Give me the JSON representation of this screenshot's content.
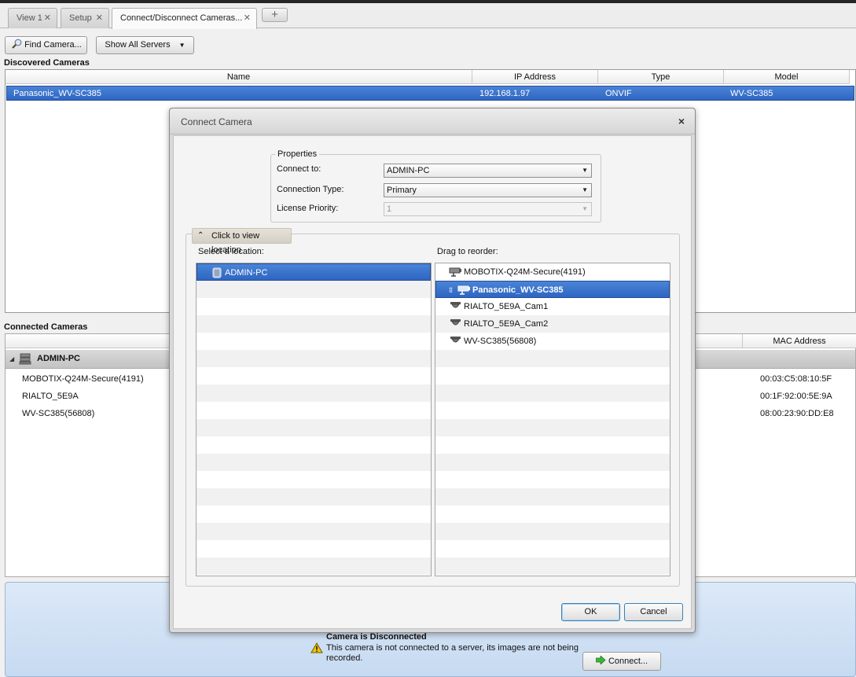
{
  "tabs": [
    {
      "label": "View 1",
      "active": false
    },
    {
      "label": "Setup",
      "active": false
    },
    {
      "label": "Connect/Disconnect Cameras...",
      "active": true
    }
  ],
  "add_tab_label": "+",
  "toolbar": {
    "find_camera_label": "Find Camera...",
    "show_all_servers_label": "Show All Servers"
  },
  "discovered": {
    "title": "Discovered Cameras",
    "columns": [
      "Name",
      "IP Address",
      "Type",
      "Model"
    ],
    "rows": [
      {
        "name": "Panasonic_WV-SC385",
        "ip": "192.168.1.97",
        "type": "ONVIF",
        "model": "WV-SC385"
      }
    ]
  },
  "connected": {
    "title": "Connected Cameras",
    "mac_column": "MAC Address",
    "server": "ADMIN-PC",
    "rows": [
      {
        "name": "MOBOTIX-Q24M-Secure(4191)",
        "mac": "00:03:C5:08:10:5F"
      },
      {
        "name": "RIALTO_5E9A",
        "mac": "00:1F:92:00:5E:9A"
      },
      {
        "name": "WV-SC385(56808)",
        "mac": "08:00:23:90:DD:E8"
      }
    ]
  },
  "dialog": {
    "title": "Connect Camera",
    "close_glyph": "×",
    "properties": {
      "legend": "Properties",
      "connect_to_label": "Connect to:",
      "connect_to_value": "ADMIN-PC",
      "connection_type_label": "Connection Type:",
      "connection_type_value": "Primary",
      "license_priority_label": "License Priority:",
      "license_priority_value": "1"
    },
    "location": {
      "toggle_label": "Click to view location",
      "select_label": "Select a location:",
      "locations": [
        "ADMIN-PC"
      ],
      "reorder_label": "Drag to reorder:",
      "cameras": [
        {
          "name": "MOBOTIX-Q24M-Secure(4191)",
          "icon": "box-camera-icon",
          "selected": false
        },
        {
          "name": "Panasonic_WV-SC385",
          "icon": "box-camera-icon",
          "selected": true
        },
        {
          "name": "RIALTO_5E9A_Cam1",
          "icon": "dome-camera-icon",
          "selected": false
        },
        {
          "name": "RIALTO_5E9A_Cam2",
          "icon": "dome-camera-icon",
          "selected": false
        },
        {
          "name": "WV-SC385(56808)",
          "icon": "dome-camera-icon",
          "selected": false
        }
      ]
    },
    "ok_label": "OK",
    "cancel_label": "Cancel"
  },
  "status": {
    "title": "Camera is Disconnected",
    "message": "This camera is not connected to a server, its images are not being recorded.",
    "connect_label": "Connect..."
  },
  "colors": {
    "selection": "#2f66c2",
    "status_bar": "#c6daf1"
  }
}
